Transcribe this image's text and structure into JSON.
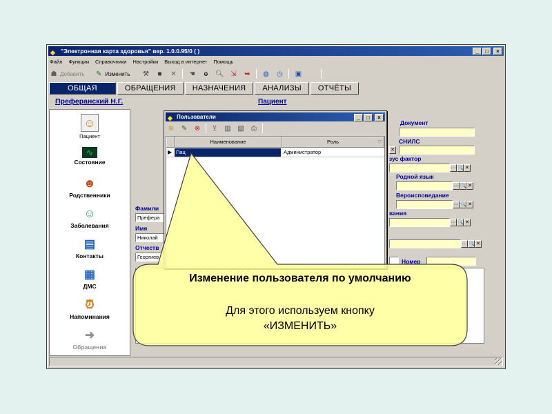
{
  "window": {
    "title": "\"Электронная карта здоровья\" вер. 1.0.0.95/0 ( )",
    "controls": [
      "_",
      "□",
      "×"
    ]
  },
  "menu": [
    "Файл",
    "Функции",
    "Справочники",
    "Настройки",
    "Выход в интернет",
    "Помощь"
  ],
  "toolbar": {
    "add_label": "Добавить",
    "edit_label": "Изменить"
  },
  "tabs": [
    "ОБЩАЯ",
    "ОБРАЩЕНИЯ",
    "НАЗНАЧЕНИЯ",
    "АНАЛИЗЫ",
    "ОТЧЁТЫ"
  ],
  "header": {
    "patient_name": "Преферанский Н.Г.",
    "patient_link": "Пациент"
  },
  "sidebar": {
    "items": [
      {
        "label": "Пациент",
        "icon": "person-icon"
      },
      {
        "label": "Состояние",
        "icon": "heart-monitor-icon"
      },
      {
        "label": "Родственники",
        "icon": "people-icon"
      },
      {
        "label": "Заболевания",
        "icon": "doctor-icon"
      },
      {
        "label": "Контакты",
        "icon": "contact-card-icon"
      },
      {
        "label": "ДМС",
        "icon": "insurance-icon"
      },
      {
        "label": "Напоминания",
        "icon": "alarm-clock-icon"
      },
      {
        "label": "Обращения",
        "icon": "arrow-icon"
      }
    ]
  },
  "form": {
    "surname_label": "Фамили",
    "surname_value": "Префера",
    "name_label": "Имя",
    "name_value": "Николай",
    "patronymic_label": "Отчеств",
    "patronymic_value": "Георгиев",
    "document_label": "Документ",
    "snils_label": "СНИЛС",
    "status_factor_label": "зус фактор",
    "native_lang_label": "Родной язык",
    "religion_label": "Вероисповедание",
    "education_label": "вания",
    "number_label": "Номер",
    "lookup_buttons": [
      "···",
      "🔍",
      "✕"
    ]
  },
  "dialog": {
    "title": "Пользователи",
    "columns": [
      "Наименование",
      "Роль"
    ],
    "rows": [
      {
        "name": "Пац",
        "role": "Администратор"
      }
    ]
  },
  "callout": {
    "title": "Изменение пользователя по умолчанию",
    "line1": "Для этого используем кнопку",
    "line2": "«ИЗМЕНИТЬ»"
  }
}
